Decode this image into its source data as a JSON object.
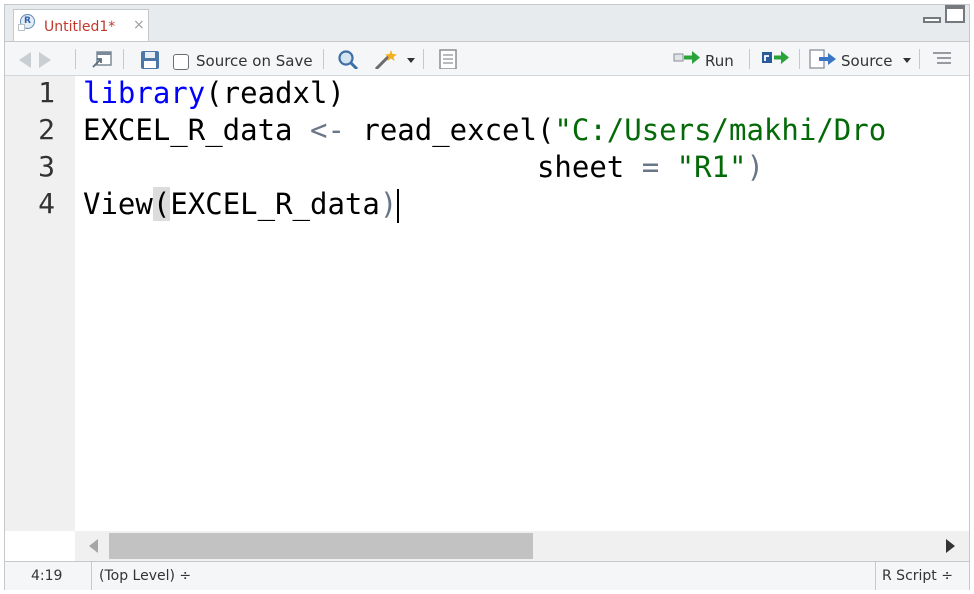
{
  "tab": {
    "title": "Untitled1*",
    "close": "×",
    "badge": "R"
  },
  "toolbar": {
    "source_on_save": "Source on Save",
    "run": "Run",
    "source": "Source"
  },
  "gutter": [
    "1",
    "2",
    "3",
    "4"
  ],
  "code": {
    "line1": {
      "kw": "library",
      "rest": "(readxl)"
    },
    "line2": {
      "a": "EXCEL_R_data ",
      "op": "<-",
      "b": " read_excel(",
      "str": "\"C:/Users/makhi/Dro"
    },
    "line3": {
      "indent": "                          sheet ",
      "op": "=",
      "sp": " ",
      "str": "\"R1\"",
      "close": ")"
    },
    "line4": {
      "fn": "View",
      "open": "(",
      "arg": "EXCEL_R_data",
      "close": ")"
    }
  },
  "status": {
    "position": "4:19",
    "scope": "(Top Level) ÷",
    "filetype": "R Script ÷"
  },
  "colors": {
    "keyword": "#0000ff",
    "string": "#036a07",
    "tab_title": "#c0392b"
  }
}
